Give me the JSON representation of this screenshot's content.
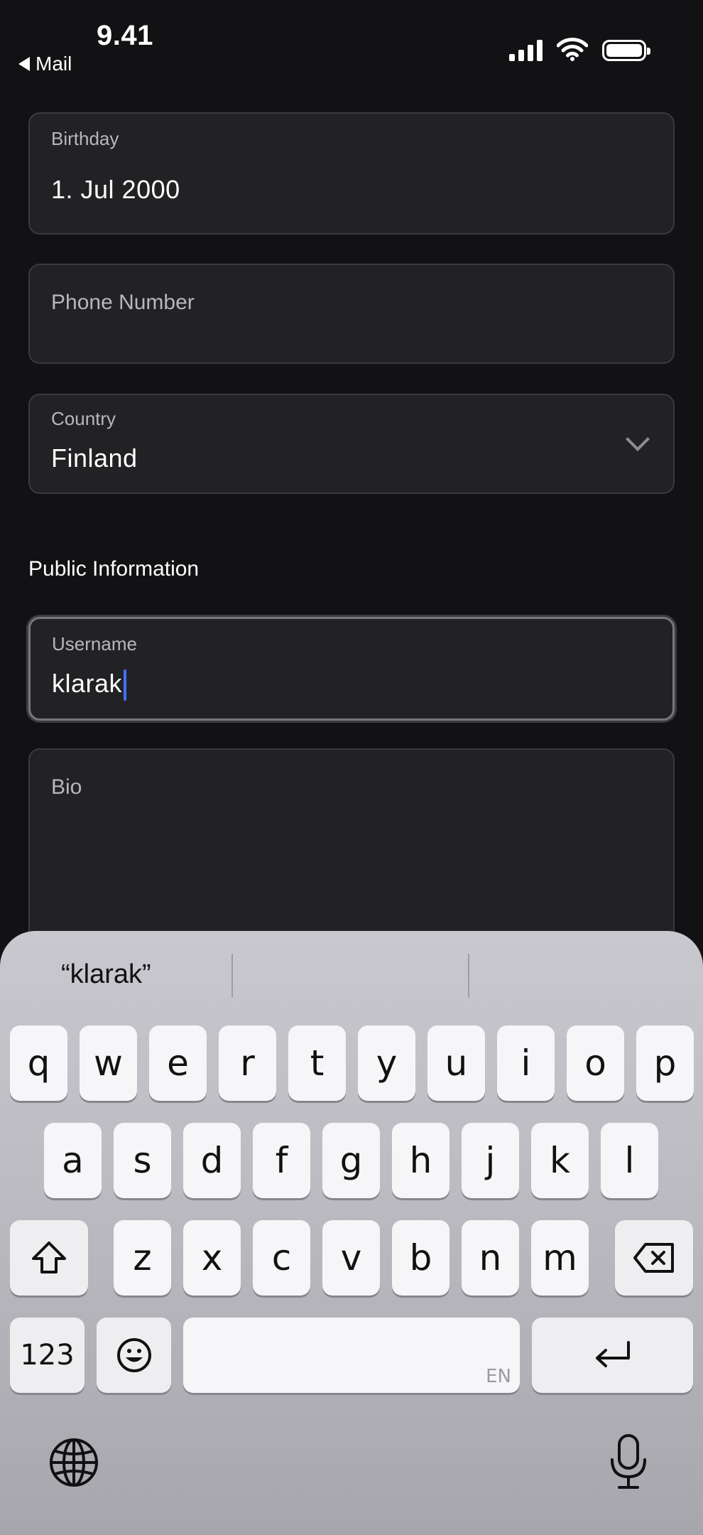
{
  "status_bar": {
    "time": "9.41",
    "back_label": "Mail"
  },
  "form": {
    "birthday": {
      "label": "Birthday",
      "value": "1. Jul 2000"
    },
    "phone": {
      "label": "Phone Number",
      "value": ""
    },
    "country": {
      "label": "Country",
      "value": "Finland"
    },
    "section_public": "Public Information",
    "username": {
      "label": "Username",
      "value": "klarak"
    },
    "bio": {
      "label": "Bio",
      "value": ""
    }
  },
  "keyboard": {
    "suggestions": [
      "“klarak”",
      "",
      ""
    ],
    "row1": [
      "q",
      "w",
      "e",
      "r",
      "t",
      "y",
      "u",
      "i",
      "o",
      "p"
    ],
    "row2": [
      "a",
      "s",
      "d",
      "f",
      "g",
      "h",
      "j",
      "k",
      "l"
    ],
    "row3": [
      "z",
      "x",
      "c",
      "v",
      "b",
      "n",
      "m"
    ],
    "numbers_key": "123",
    "space_lang": "EN",
    "icons": [
      "shift-icon",
      "delete-icon",
      "emoji-icon",
      "return-icon",
      "globe-icon",
      "microphone-icon"
    ]
  }
}
